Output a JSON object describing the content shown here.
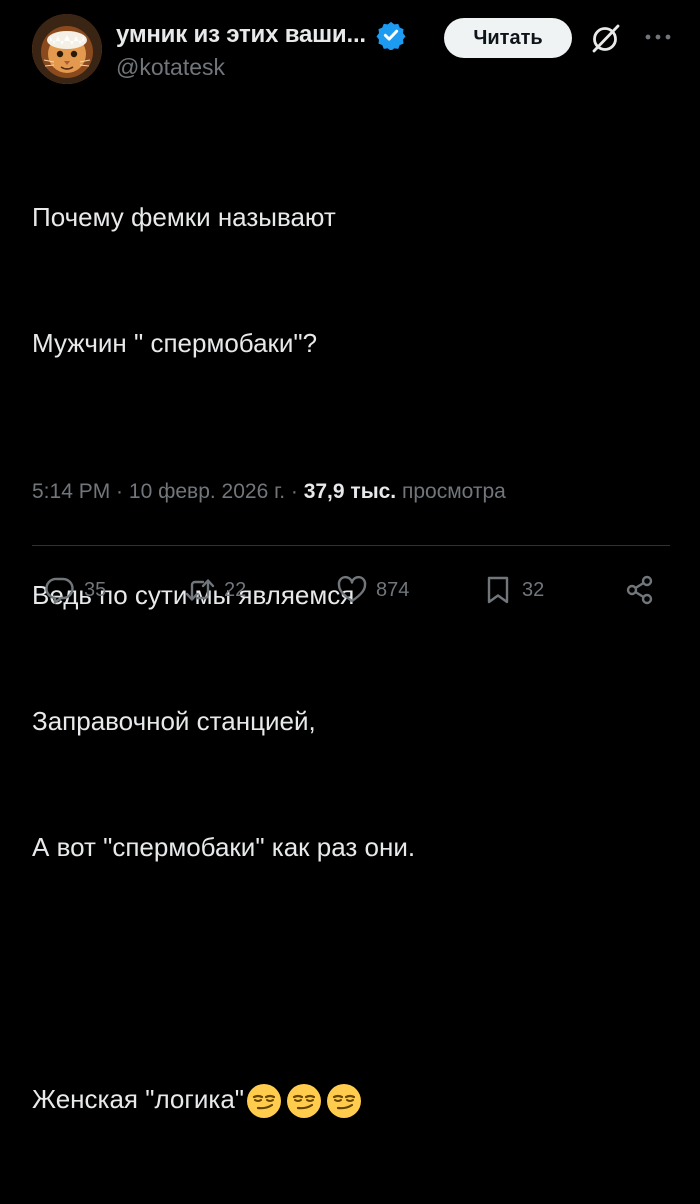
{
  "author": {
    "display_name": "умник из этих ваши...",
    "handle": "@kotatesk",
    "avatar_icon": "lion-cat-avatar",
    "verified_icon": "verified-badge-icon",
    "verified_color": "#1d9bf0"
  },
  "header": {
    "follow_label": "Читать",
    "grok_icon": "grok-icon",
    "more_icon": "more-icon"
  },
  "tweet": {
    "lines": [
      "Почему фемки называют",
      "Мужчин \" спермобаки\"?",
      "",
      "Ведь по сути мы являемся",
      "Заправочной станцией,",
      "А вот \"спермобаки\" как раз они.",
      "",
      "Женская \"логика\""
    ],
    "emojis": [
      "smirking-face",
      "smirking-face",
      "smirking-face"
    ]
  },
  "meta": {
    "time": "5:14 PM",
    "separator1": " · ",
    "date": "10 февр. 2026 г.",
    "separator2": " · ",
    "views_count": "37,9 тыс.",
    "views_label": " просмотра"
  },
  "actions": {
    "replies": "35",
    "reposts": "22",
    "likes": "874",
    "bookmarks": "32"
  },
  "colors": {
    "background": "#000000",
    "text": "#e7e9ea",
    "secondary": "#71767b",
    "accent": "#1d9bf0",
    "divider": "#2f3336"
  }
}
